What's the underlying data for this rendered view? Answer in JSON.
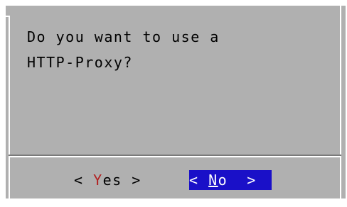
{
  "dialog": {
    "question_line1": "Do you want to use a",
    "question_line2": "HTTP-Proxy?"
  },
  "buttons": {
    "yes": {
      "open": "< ",
      "hotkey": "Y",
      "rest": "es",
      "close": " >",
      "selected": false
    },
    "no": {
      "open": "< ",
      "hotkey": "N",
      "rest": "o",
      "close": "  >",
      "selected": true
    }
  },
  "colors": {
    "dialog_bg": "#b0b0b0",
    "hotkey": "#b22020",
    "selected_bg": "#1a10c8",
    "selected_fg": "#ffffff"
  }
}
